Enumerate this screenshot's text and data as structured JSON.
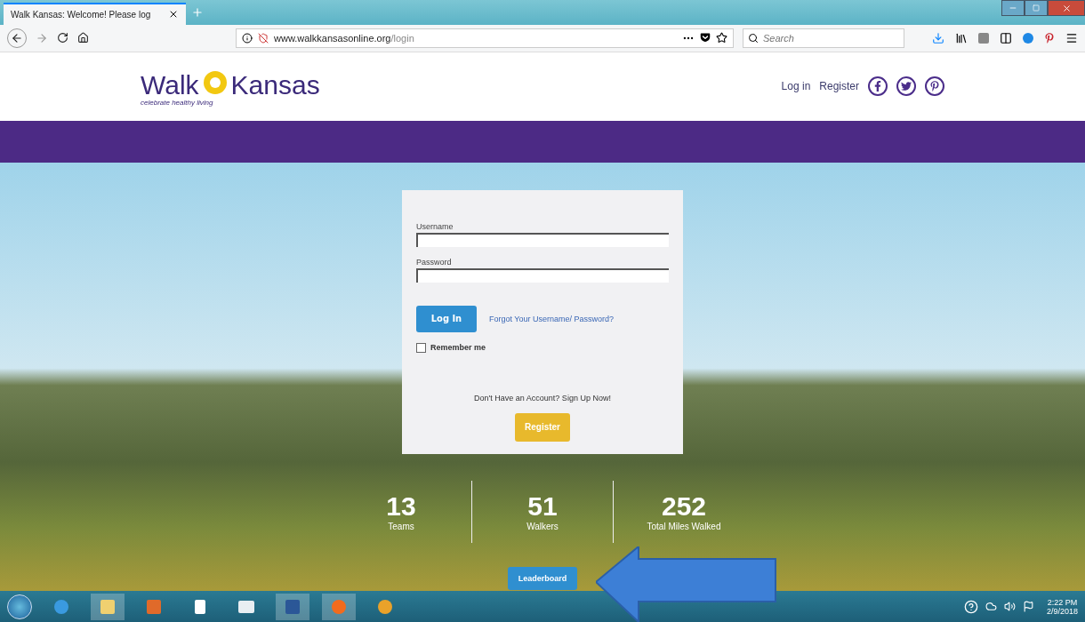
{
  "browser": {
    "tab_title": "Walk Kansas: Welcome! Please log",
    "url_host": "www.walkkansasonline.org",
    "url_path": "/login",
    "search": {
      "placeholder": "Search"
    }
  },
  "site": {
    "logo": {
      "word1": "Walk",
      "word2": "Kansas",
      "tagline": "celebrate healthy living"
    },
    "nav": [
      "Log in",
      "Register"
    ]
  },
  "login": {
    "username_label": "Username",
    "password_label": "Password",
    "login_button": "Log In",
    "forgot_link": "Forgot Your Username/ Password?",
    "remember": {
      "label": "Remember me",
      "checked": false
    },
    "signup_prompt": "Don't Have an Account? Sign Up Now!",
    "register_button": "Register"
  },
  "stats": [
    {
      "value": "13",
      "label": "Teams"
    },
    {
      "value": "51",
      "label": "Walkers"
    },
    {
      "value": "252",
      "label": "Total Miles Walked"
    }
  ],
  "leaderboard_button": "Leaderboard",
  "taskbar": {
    "time": "2:22 PM",
    "date": "2/9/2018"
  }
}
